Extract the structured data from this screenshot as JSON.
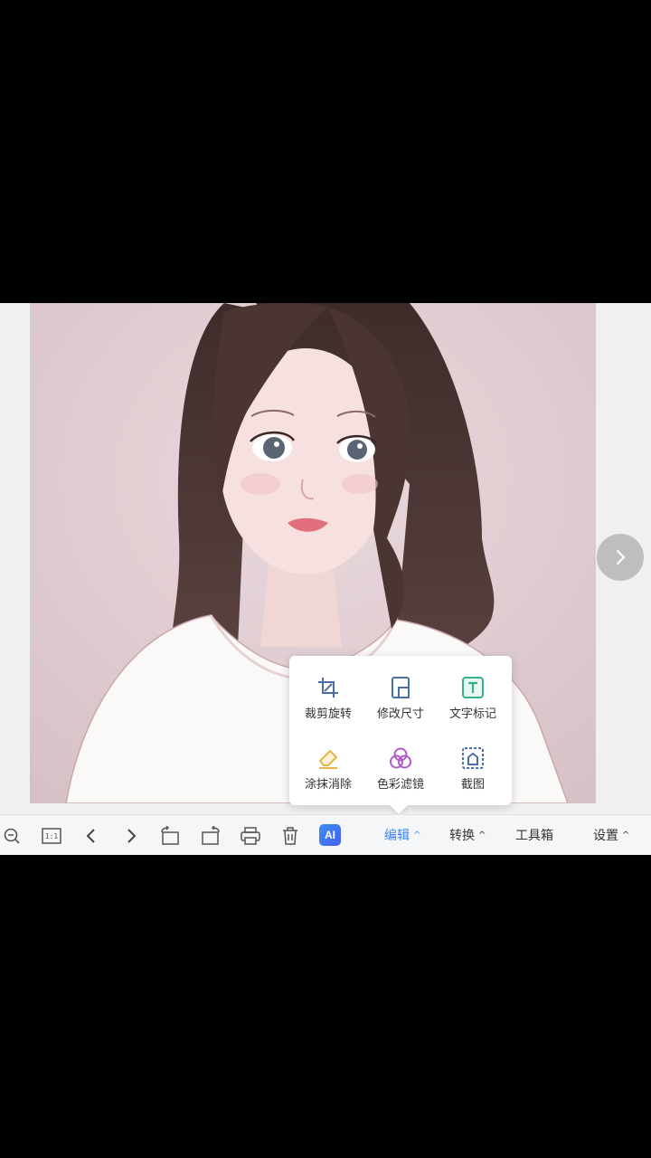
{
  "toolbar": {
    "one_to_one_label": "1:1",
    "ai_label": "AI",
    "menus": {
      "edit": "编辑",
      "convert": "转换",
      "toolbox": "工具箱",
      "settings": "设置"
    }
  },
  "edit_popup": {
    "items": [
      {
        "label": "裁剪旋转",
        "icon": "crop-rotate-icon"
      },
      {
        "label": "修改尺寸",
        "icon": "resize-icon"
      },
      {
        "label": "文字标记",
        "icon": "text-mark-icon"
      },
      {
        "label": "涂抹消除",
        "icon": "eraser-icon"
      },
      {
        "label": "色彩滤镜",
        "icon": "color-filter-icon"
      },
      {
        "label": "截图",
        "icon": "screenshot-icon"
      }
    ]
  },
  "colors": {
    "accent": "#3b82f6",
    "photo_background": "#dcc9cd",
    "hair": "#4b3634",
    "shirt": "#fbf8f8"
  }
}
